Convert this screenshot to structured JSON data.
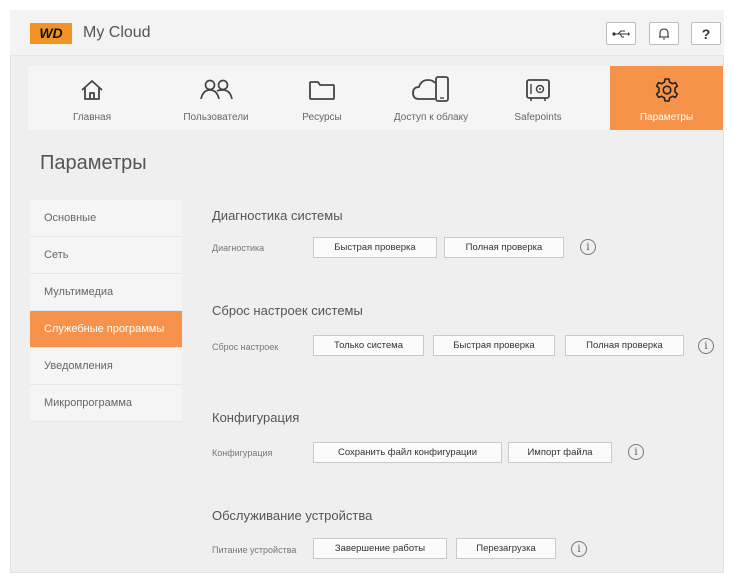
{
  "header": {
    "logo": "WD",
    "title": "My Cloud"
  },
  "nav": [
    {
      "label": "Главная",
      "icon": "home-icon"
    },
    {
      "label": "Пользователи",
      "icon": "users-icon"
    },
    {
      "label": "Ресурсы",
      "icon": "folder-icon"
    },
    {
      "label": "Доступ к облаку",
      "icon": "cloud-device-icon"
    },
    {
      "label": "Safepoints",
      "icon": "safe-icon"
    },
    {
      "label": "Параметры",
      "icon": "gear-icon",
      "active": true
    }
  ],
  "page_title": "Параметры",
  "sidebar": [
    {
      "label": "Основные"
    },
    {
      "label": "Сеть"
    },
    {
      "label": "Мультимедиа"
    },
    {
      "label": "Служебные программы",
      "active": true
    },
    {
      "label": "Уведомления"
    },
    {
      "label": "Микропрограмма"
    }
  ],
  "sections": {
    "diagnostics": {
      "title": "Диагностика системы",
      "label": "Диагностика",
      "quick": "Быстрая проверка",
      "full": "Полная проверка"
    },
    "reset": {
      "title": "Сброс настроек системы",
      "label": "Сброс настроек",
      "system_only": "Только система",
      "quick": "Быстрая проверка",
      "full": "Полная проверка"
    },
    "config": {
      "title": "Конфигурация",
      "label": "Конфигурация",
      "save": "Сохранить файл конфигурации",
      "import": "Импорт файла"
    },
    "maintenance": {
      "title": "Обслуживание устройства",
      "label": "Питание устройства",
      "shutdown": "Завершение работы",
      "reboot": "Перезагрузка"
    }
  },
  "info_glyph": "i",
  "help_glyph": "?",
  "colors": {
    "accent": "#f7924a",
    "logo_bg": "#f19325"
  }
}
